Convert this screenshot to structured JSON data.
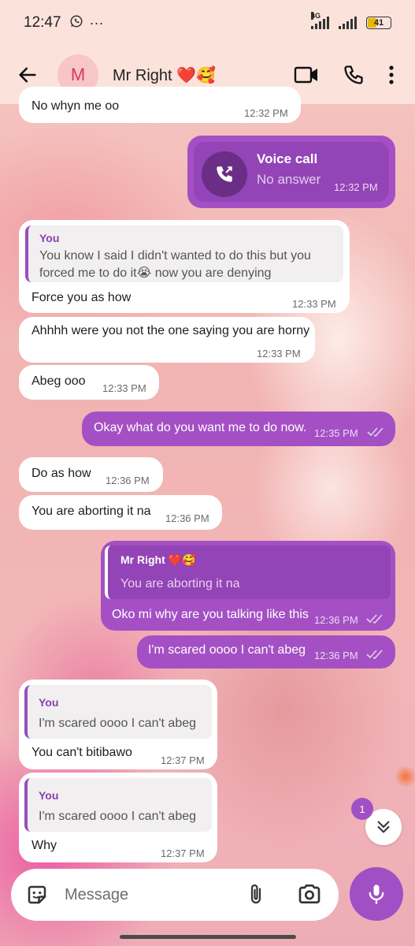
{
  "status_bar": {
    "time": "12:47",
    "whatsapp_icon": "whatsapp-icon",
    "more_dots": "···",
    "network": "4G",
    "battery": "41"
  },
  "header": {
    "avatar_letter": "M",
    "contact_name": "Mr Right ❤️🥰"
  },
  "messages": [
    {
      "text": "No whyn me oo",
      "time": "12:32 PM"
    },
    {
      "title": "Voice call",
      "subtitle": "No answer",
      "time": "12:32 PM"
    },
    {
      "quote_author": "You",
      "quote_line1": "You know I said I didn't wanted to do this but you",
      "quote_line2": "forced me to do it😭 now you are denying",
      "text": "Force  you as how",
      "time": "12:33 PM"
    },
    {
      "text": "Ahhhh were you not the one saying you are horny",
      "time": "12:33 PM"
    },
    {
      "text": "Abeg ooo",
      "time": "12:33 PM"
    },
    {
      "text": "Okay what do you want me to do now.",
      "time": "12:35 PM"
    },
    {
      "text": "Do as how",
      "time": "12:36 PM"
    },
    {
      "text": "You are aborting it na",
      "time": "12:36 PM"
    },
    {
      "quote_author": "Mr Right ❤️🥰",
      "quote_text": "You are aborting it na",
      "text": "Oko mi why are you talking like this",
      "time": "12:36 PM"
    },
    {
      "text": "I'm scared oooo I can't abeg",
      "time": "12:36 PM"
    },
    {
      "quote_author": "You",
      "quote_text": "I'm scared oooo I can't abeg",
      "text": "You can't  bitibawo",
      "time": "12:37 PM"
    },
    {
      "quote_author": "You",
      "quote_text": "I'm scared oooo I can't abeg",
      "text": "Why",
      "time": "12:37 PM"
    }
  ],
  "unread_count": "1",
  "composer": {
    "placeholder": "Message"
  },
  "colors": {
    "accent": "#a450c4",
    "header_bg": "#fbe3dc",
    "incoming_bubble": "#ffffff"
  }
}
